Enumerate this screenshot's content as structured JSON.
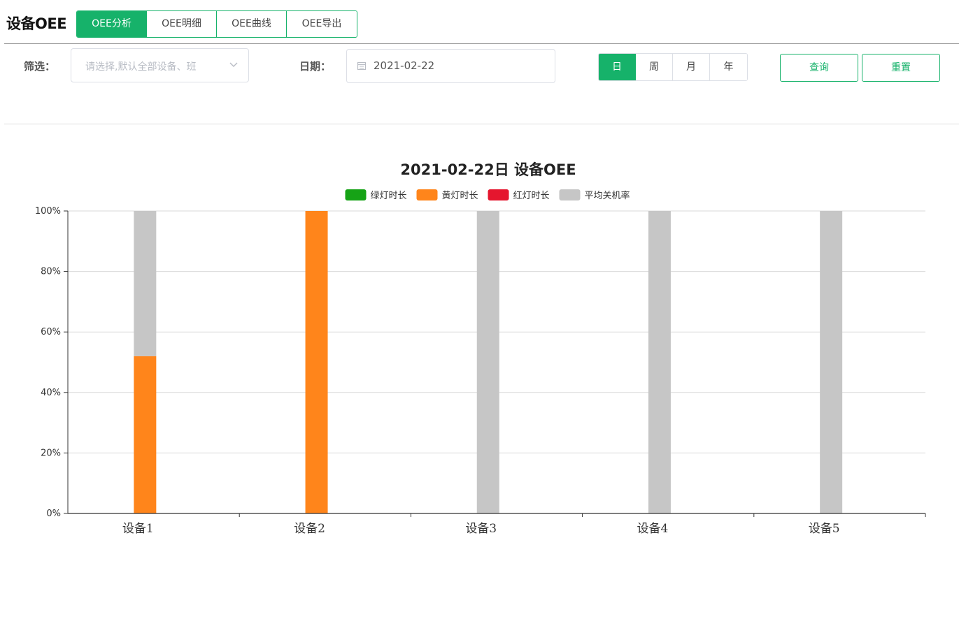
{
  "header": {
    "title": "设备OEE",
    "tabs": [
      {
        "label": "OEE分析",
        "active": true
      },
      {
        "label": "OEE明细",
        "active": false
      },
      {
        "label": "OEE曲线",
        "active": false
      },
      {
        "label": "OEE导出",
        "active": false
      }
    ]
  },
  "filters": {
    "filter_label": "筛选：",
    "select_placeholder": "请选择,默认全部设备、班",
    "date_label": "日期：",
    "date_value": "2021-02-22",
    "periods": [
      {
        "label": "日",
        "active": true
      },
      {
        "label": "周",
        "active": false
      },
      {
        "label": "月",
        "active": false
      },
      {
        "label": "年",
        "active": false
      }
    ],
    "query_label": "查询",
    "reset_label": "重置"
  },
  "colors": {
    "accent": "#16b26a"
  },
  "chart_data": {
    "type": "bar",
    "stacked": true,
    "title": "2021-02-22日 设备OEE",
    "categories": [
      "设备1",
      "设备2",
      "设备3",
      "设备4",
      "设备5"
    ],
    "series": [
      {
        "name": "绿灯时长",
        "color": "#16a316",
        "values": [
          0,
          0,
          0,
          0,
          0
        ]
      },
      {
        "name": "黄灯时长",
        "color": "#ff851b",
        "values": [
          52,
          100,
          0,
          0,
          0
        ]
      },
      {
        "name": "红灯时长",
        "color": "#e5162e",
        "values": [
          0,
          0,
          0,
          0,
          0
        ]
      },
      {
        "name": "平均关机率",
        "color": "#c6c6c6",
        "values": [
          48,
          0,
          100,
          100,
          100
        ]
      }
    ],
    "yticks": [
      "0%",
      "20%",
      "40%",
      "60%",
      "80%",
      "100%"
    ],
    "ylim": [
      0,
      100
    ],
    "legend_position": "top-center",
    "grid": true
  }
}
